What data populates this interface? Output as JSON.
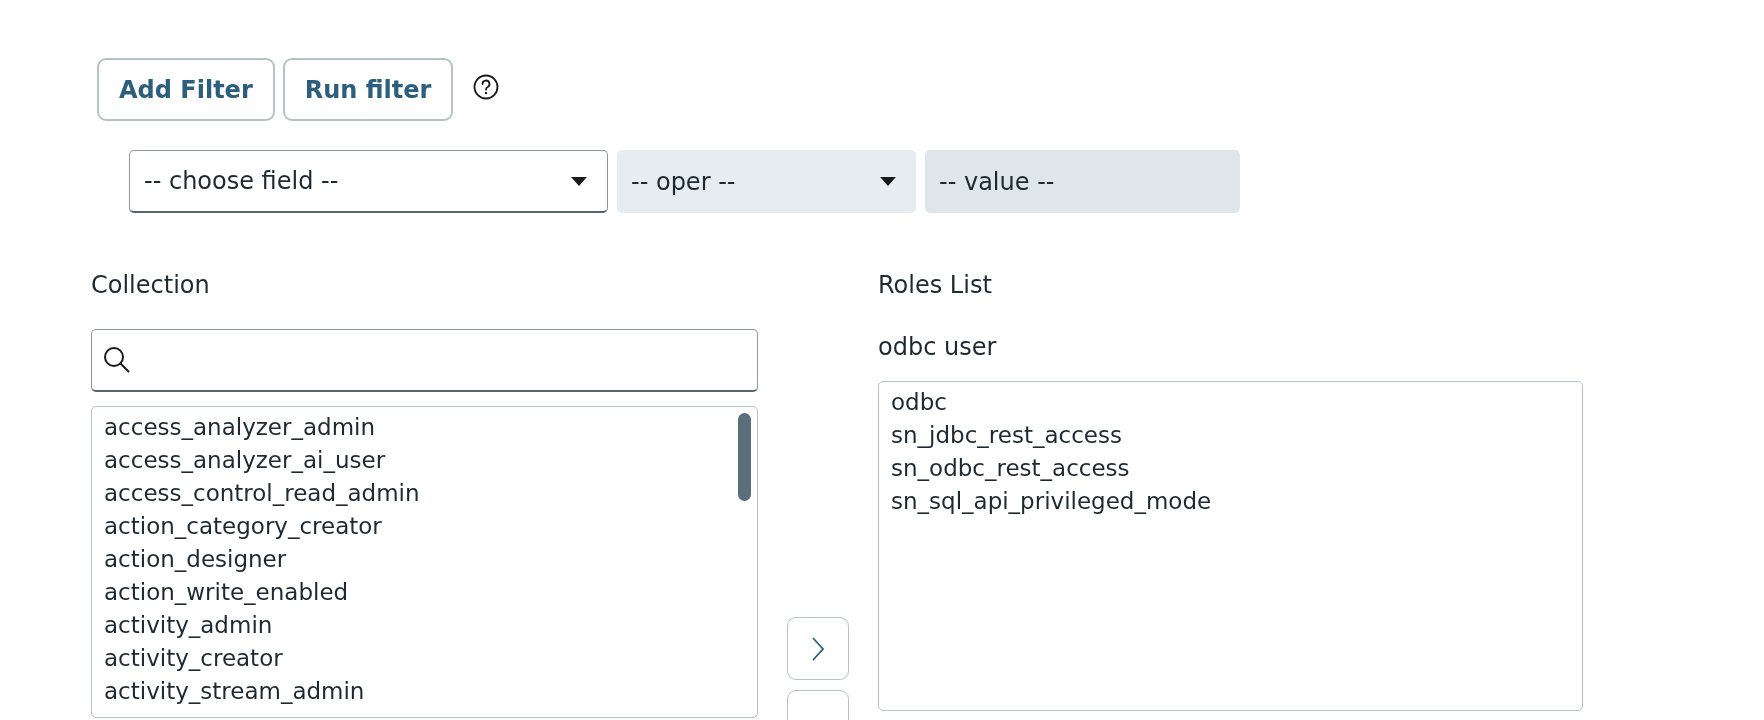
{
  "toolbar": {
    "buttons": [
      "Add Filter",
      "Run filter"
    ]
  },
  "filter": {
    "field": "-- choose field --",
    "operator": "-- oper --",
    "value": {
      "placeholder": "-- value --"
    }
  },
  "collection": {
    "label": "Collection",
    "items": [
      "access_analyzer_admin",
      "access_analyzer_ai_user",
      "access_control_read_admin",
      "action_category_creator",
      "action_designer",
      "action_write_enabled",
      "activity_admin",
      "activity_creator",
      "activity_stream_admin"
    ]
  },
  "roles": {
    "label": "Roles List",
    "subtitle": "odbc user",
    "items": [
      "odbc",
      "sn_jdbc_rest_access",
      "sn_odbc_rest_access",
      "sn_sql_api_privileged_mode"
    ]
  }
}
